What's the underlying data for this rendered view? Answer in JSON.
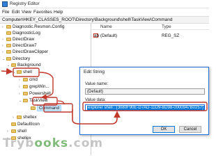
{
  "window": {
    "title": "Registry Editor"
  },
  "menu": [
    "File",
    "Edit",
    "View",
    "Favorites",
    "Help"
  ],
  "address": "Computer\\HKEY_CLASSES_ROOT\\Directory\\Background\\shell\\TaskView\\Command",
  "tree": {
    "items": [
      {
        "label": "Diagnostic.Resmon.Config",
        "expander": "›"
      },
      {
        "label": "DiagnosticLog",
        "expander": ""
      },
      {
        "label": "DirectDraw",
        "expander": "›"
      },
      {
        "label": "DirectDraw7",
        "expander": "›"
      },
      {
        "label": "DirectDrawClipper",
        "expander": "›"
      },
      {
        "label": "Directory",
        "expander": "⌄"
      },
      {
        "label": "Background",
        "expander": "⌄"
      },
      {
        "label": "shell",
        "expander": "⌄"
      },
      {
        "label": "cmd",
        "expander": "›"
      },
      {
        "label": "grepWin...",
        "expander": "›"
      },
      {
        "label": "Powershell",
        "expander": "›"
      },
      {
        "label": "TaskView",
        "expander": "⌄"
      },
      {
        "label": "Command",
        "expander": ""
      },
      {
        "label": "shellex",
        "expander": "›"
      },
      {
        "label": "DefaultIcon",
        "expander": ""
      },
      {
        "label": "shell",
        "expander": "›"
      },
      {
        "label": "shellex",
        "expander": "›"
      }
    ]
  },
  "values": {
    "columns": {
      "name": "Name",
      "type": "Type"
    },
    "rows": [
      {
        "icon": "ab",
        "name": "(Default)",
        "type": "REG_SZ"
      }
    ]
  },
  "dialog": {
    "title": "Edit String",
    "value_name_label": "Value name:",
    "value_name": "(Default)",
    "value_data_label": "Value data:",
    "value_data": "explorer shell:::{3080F90E-D7AD-11D9-BD98-0000947B0257}",
    "ok_label": "OK",
    "cancel_label": "Cancel"
  },
  "watermark": {
    "part1": "Tryb",
    "part2": "ooks",
    "suffix": ".com"
  },
  "colors": {
    "annotation": "#c0392b",
    "selection": "#0078d7"
  }
}
